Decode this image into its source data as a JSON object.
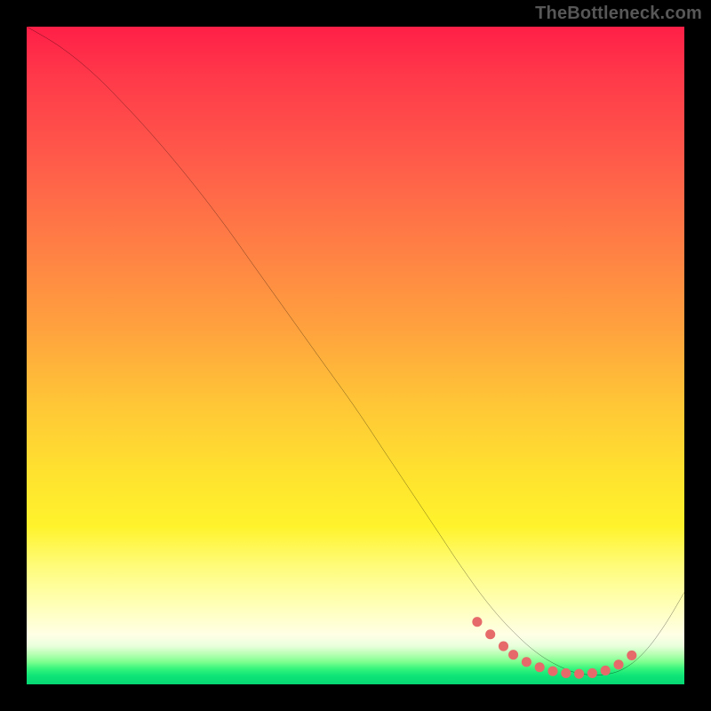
{
  "watermark": {
    "text": "TheBottleneck.com"
  },
  "chart_data": {
    "type": "line",
    "title": "",
    "xlabel": "",
    "ylabel": "",
    "xlim": [
      0,
      100
    ],
    "ylim": [
      0,
      100
    ],
    "grid": false,
    "legend": false,
    "series": [
      {
        "name": "bottleneck-curve",
        "color": "#000000",
        "x": [
          0,
          5,
          10,
          15,
          20,
          25,
          30,
          35,
          40,
          45,
          50,
          55,
          60,
          63,
          66,
          70,
          74,
          78,
          82,
          85,
          88,
          91,
          94,
          97,
          100
        ],
        "y": [
          100,
          97,
          93,
          88,
          82.5,
          76.5,
          70,
          63,
          56,
          49,
          42,
          34.5,
          27,
          22.5,
          18,
          12.5,
          8,
          4.5,
          2.3,
          1.5,
          1.5,
          2.5,
          5,
          9,
          14
        ]
      },
      {
        "name": "optimal-zone-markers",
        "type": "scatter",
        "color": "#e66a6a",
        "x": [
          68.5,
          70.5,
          72.5,
          74,
          76,
          78,
          80,
          82,
          84,
          86,
          88,
          90,
          92
        ],
        "y": [
          9.5,
          7.6,
          5.8,
          4.5,
          3.4,
          2.6,
          2.0,
          1.7,
          1.6,
          1.7,
          2.1,
          3.0,
          4.4
        ]
      }
    ],
    "background_gradient": {
      "direction": "top-to-bottom",
      "stops": [
        {
          "pos": 0.0,
          "color": "#ff1f47"
        },
        {
          "pos": 0.33,
          "color": "#ff7e45"
        },
        {
          "pos": 0.58,
          "color": "#ffc836"
        },
        {
          "pos": 0.82,
          "color": "#fffc7a"
        },
        {
          "pos": 0.94,
          "color": "#e8ffdc"
        },
        {
          "pos": 1.0,
          "color": "#06d873"
        }
      ]
    }
  }
}
